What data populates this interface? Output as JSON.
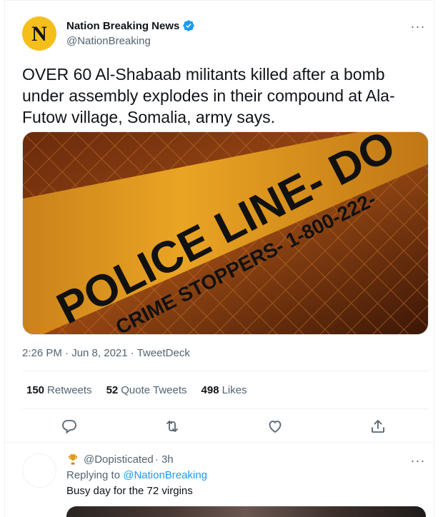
{
  "tweet": {
    "author_name": "Nation Breaking News",
    "author_handle": "@NationBreaking",
    "avatar_letter": "N",
    "text": "OVER 60 Al-Shabaab militants killed after a bomb under assembly explodes in their compound at Ala-Futow village, Somalia, army says.",
    "media_text_main": "POLICE LINE- DO",
    "media_text_sub": "CRIME STOPPERS- 1-800-222-",
    "timestamp": "2:26 PM · Jun 8, 2021 · TweetDeck",
    "stats": {
      "retweets_count": "150",
      "retweets_label": "Retweets",
      "quotes_count": "52",
      "quotes_label": "Quote Tweets",
      "likes_count": "498",
      "likes_label": "Likes"
    },
    "more_glyph": "···"
  },
  "reply": {
    "author_handle": "@Dopisticated",
    "time": "· 3h",
    "replying_label": "Replying to",
    "replying_to": "@NationBreaking",
    "text": "Busy day for the 72 virgins"
  },
  "colors": {
    "accent": "#1d9bf0",
    "secondary_text": "#536471",
    "avatar_bg": "#f5bf1b",
    "tape": "#e8a21a"
  }
}
